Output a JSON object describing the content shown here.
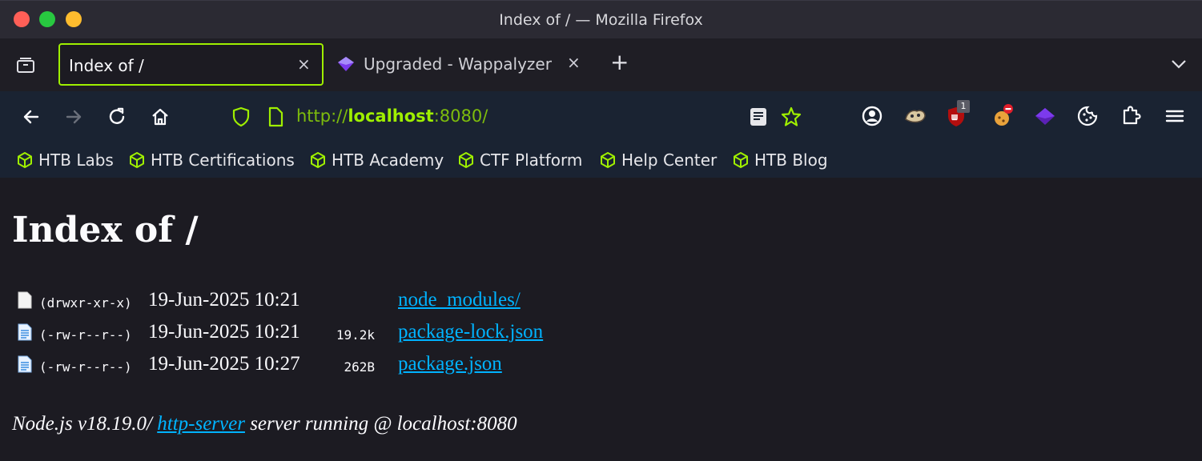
{
  "window": {
    "title": "Index of / — Mozilla Firefox"
  },
  "tabs": [
    {
      "label": "Index of /",
      "active": true
    },
    {
      "label": "Upgraded - Wappalyzer",
      "active": false
    }
  ],
  "tab_close_glyph": "×",
  "new_tab_glyph": "+",
  "urlbar": {
    "scheme": "http://",
    "host": "localhost",
    "rest": ":8080/"
  },
  "bookmarks": [
    {
      "label": "HTB Labs"
    },
    {
      "label": "HTB Certifications"
    },
    {
      "label": "HTB Academy"
    },
    {
      "label": "CTF Platform"
    },
    {
      "label": "Help Center"
    },
    {
      "label": "HTB Blog"
    }
  ],
  "extensions": {
    "ublock_badge": "1"
  },
  "page": {
    "heading": "Index of /",
    "entries": [
      {
        "perm": "(drwxr-xr-x)",
        "date": "19-Jun-2025 10:21",
        "size": "",
        "name": "node_modules/"
      },
      {
        "perm": "(-rw-r--r--)",
        "date": "19-Jun-2025 10:21",
        "size": "19.2k",
        "name": "package-lock.json"
      },
      {
        "perm": "(-rw-r--r--)",
        "date": "19-Jun-2025 10:27",
        "size": "262B",
        "name": "package.json"
      }
    ],
    "footer": {
      "prefix": "Node.js v18.19.0/ ",
      "link": "http-server",
      "suffix": " server running @ localhost:8080"
    }
  },
  "colors": {
    "accent": "#9fef00",
    "link": "#00b3ff",
    "toolbar_bg": "#1a2332",
    "page_bg": "#1c1b22"
  }
}
